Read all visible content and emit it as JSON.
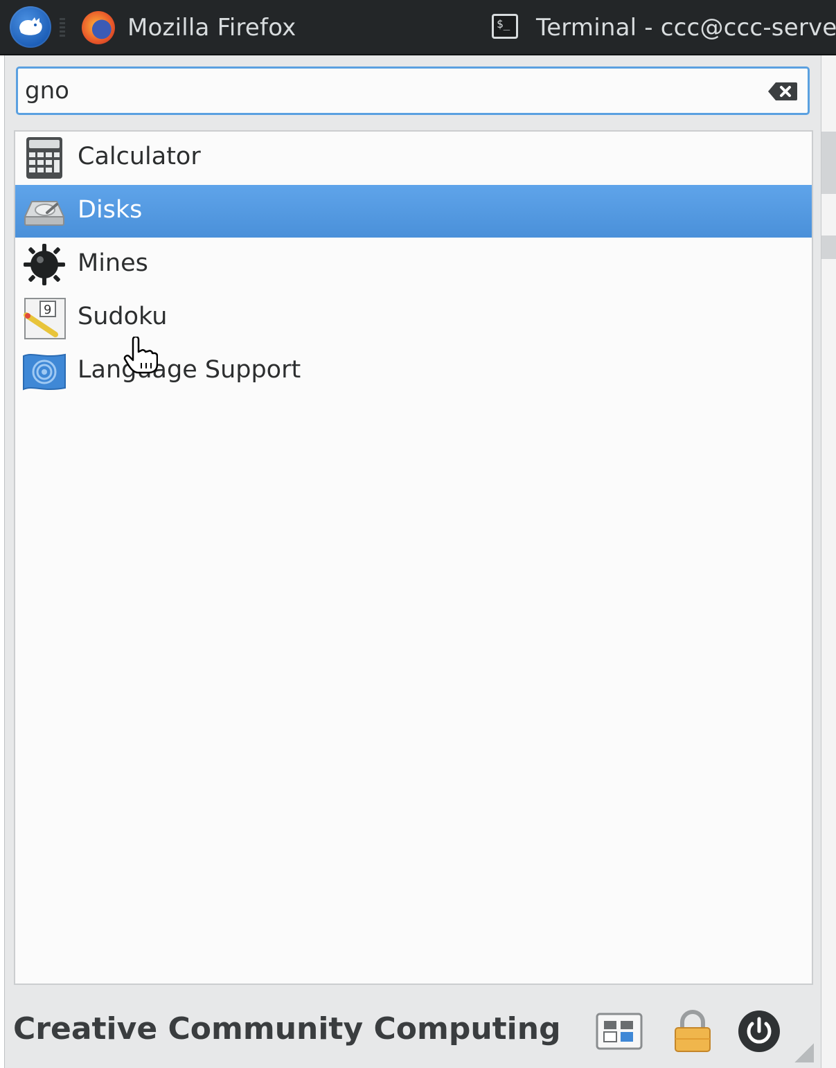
{
  "taskbar": {
    "tasks": [
      {
        "label": "Mozilla Firefox",
        "icon": "firefox-icon"
      },
      {
        "label": "Terminal - ccc@ccc-server",
        "icon": "terminal-icon"
      }
    ],
    "terminal_prompt_glyph": "$_"
  },
  "search": {
    "value": "gno"
  },
  "results": [
    {
      "label": "Calculator",
      "icon": "calculator-icon",
      "selected": false
    },
    {
      "label": "Disks",
      "icon": "disks-icon",
      "selected": true
    },
    {
      "label": "Mines",
      "icon": "mines-icon",
      "selected": false
    },
    {
      "label": "Sudoku",
      "icon": "sudoku-icon",
      "selected": false
    },
    {
      "label": "Language Support",
      "icon": "language-support-icon",
      "selected": false
    }
  ],
  "footer": {
    "name": "Creative Community Computing"
  },
  "colors": {
    "selection": "#4a90d9",
    "focus_border": "#5aa0e0",
    "panel": "#232628"
  }
}
